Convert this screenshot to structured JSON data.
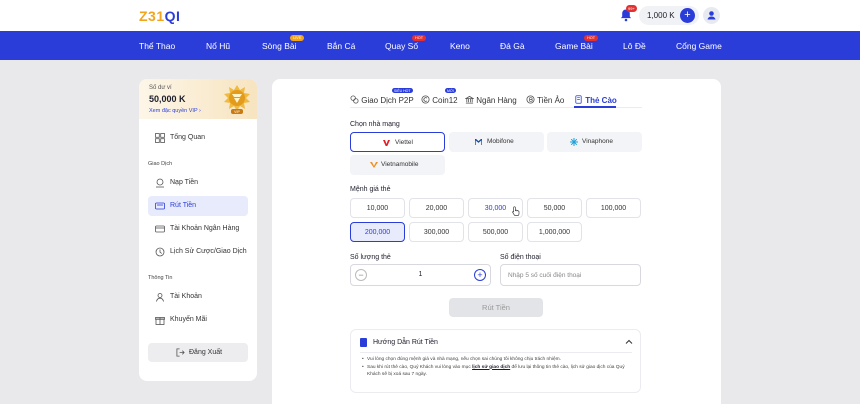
{
  "header": {
    "logo_part1": "Z31",
    "logo_part2": "QI",
    "bell_badge": "99+",
    "balance": "1,000 K",
    "plus_label": "+"
  },
  "nav": {
    "items": [
      {
        "label": "Thể Thao",
        "badge": ""
      },
      {
        "label": "Nổ Hũ",
        "badge": ""
      },
      {
        "label": "Sòng Bài",
        "badge": "LIVE"
      },
      {
        "label": "Bắn Cá",
        "badge": ""
      },
      {
        "label": "Quay Số",
        "badge": "HOT"
      },
      {
        "label": "Keno",
        "badge": ""
      },
      {
        "label": "Đá Gà",
        "badge": ""
      },
      {
        "label": "Game Bài",
        "badge": "HOT"
      },
      {
        "label": "Lô Đề",
        "badge": ""
      },
      {
        "label": "Cổng Game",
        "badge": ""
      }
    ],
    "badge_colors": {
      "LIVE": "#f2a51a",
      "HOT": "#e53030"
    }
  },
  "sidebar": {
    "balance_label": "Số dư ví",
    "balance_value": "50,000 K",
    "vip_link": "Xem đặc quyền VIP",
    "vip_text": "VIP",
    "overview": {
      "label": "Tổng Quan",
      "icon": "grid-icon"
    },
    "section_transactions": "Giao Dịch",
    "items_transactions": [
      {
        "label": "Nạp Tiền",
        "icon": "deposit-icon"
      },
      {
        "label": "Rút Tiền",
        "icon": "withdraw-icon"
      },
      {
        "label": "Tài Khoản Ngân Hàng",
        "icon": "bank-card-icon"
      },
      {
        "label": "Lịch Sử Cược/Giao Dịch",
        "icon": "history-icon"
      }
    ],
    "section_info": "Thông Tin",
    "items_info": [
      {
        "label": "Tài Khoản",
        "icon": "user-icon"
      },
      {
        "label": "Khuyến Mãi",
        "icon": "gift-icon"
      }
    ],
    "logout": "Đăng Xuất"
  },
  "tabs": [
    {
      "label": "Giao Dịch P2P",
      "badge": "SIÊU HOT",
      "icon": "p2p-icon"
    },
    {
      "label": "Coin12",
      "badge": "MỚI",
      "icon": "coin-icon"
    },
    {
      "label": "Ngân Hàng",
      "badge": "",
      "icon": "bank-icon"
    },
    {
      "label": "Tiền Ảo",
      "badge": "",
      "icon": "crypto-icon"
    },
    {
      "label": "Thẻ Cào",
      "badge": "",
      "icon": "card-icon"
    }
  ],
  "form": {
    "network_label": "Chọn nhà mạng",
    "networks": [
      "Viettel",
      "Mobifone",
      "Vinaphone",
      "Vietnamobile"
    ],
    "selected_network": "Viettel",
    "amount_label": "Mệnh giá thẻ",
    "amounts": [
      "10,000",
      "20,000",
      "30,000",
      "50,000",
      "100,000",
      "200,000",
      "300,000",
      "500,000",
      "1,000,000"
    ],
    "selected_amount": "200,000",
    "quantity_label": "Số lượng thẻ",
    "quantity": "1",
    "minus": "−",
    "plus": "+",
    "phone_label": "Số điện thoại",
    "phone_placeholder": "Nhập 5 số cuối điện thoại",
    "submit": "Rút Tiền"
  },
  "guide": {
    "title": "Hướng Dẫn Rút Tiền",
    "line1": "Vui lòng chọn đúng mệnh giá và nhà mạng, nếu chọn sai chúng tôi không chịu trách nhiệm.",
    "line2_a": "Sau khi rút thẻ cào, Quý Khách vui lòng vào mục ",
    "line2_link": "lịch sử giao dịch",
    "line2_b": " để lưu lại thông tin thẻ cào, lịch sử giao dịch của Quý Khách sẽ bị xoá sau 7 ngày."
  },
  "colors": {
    "primary": "#2b3dd8",
    "logo_accent": "#f2a51a",
    "viettel": "#e31e24",
    "mobifone": "#1a4fa0",
    "vinaphone": "#1ba0d8",
    "vietnamobile": "#f28c1a"
  }
}
